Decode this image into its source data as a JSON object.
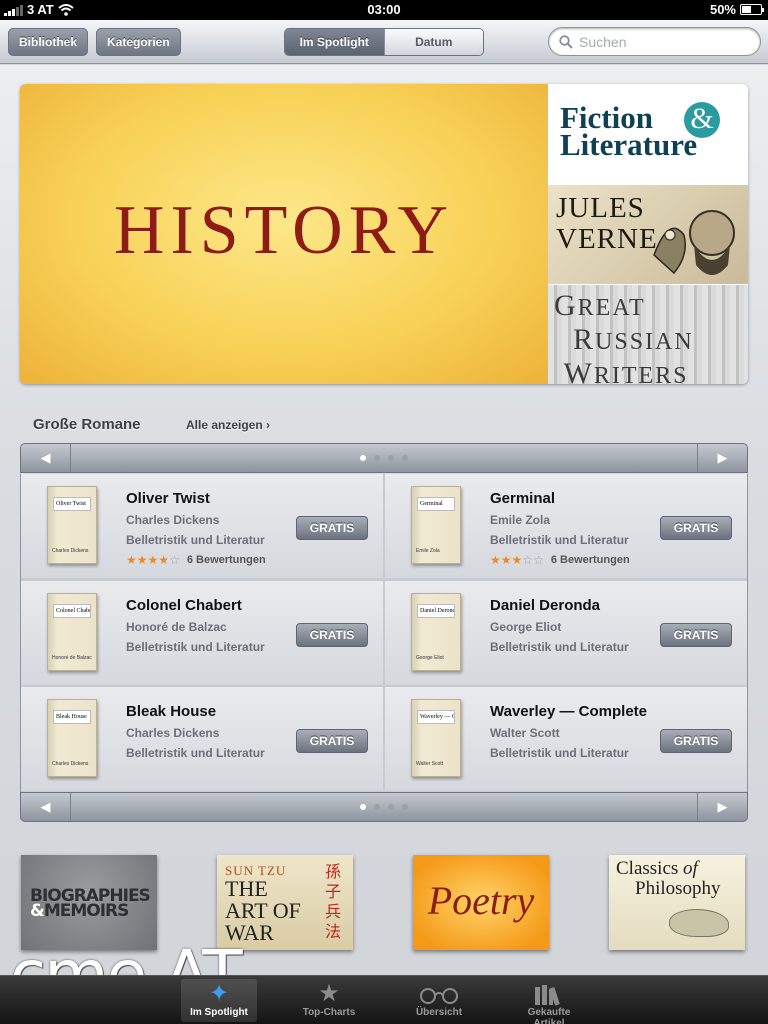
{
  "status_bar": {
    "carrier": "3 AT",
    "time": "03:00",
    "battery": "50%",
    "battery_level": 0.5
  },
  "toolbar": {
    "library_button": "Bibliothek",
    "categories_button": "Kategorien",
    "segments": [
      "Im Spotlight",
      "Datum"
    ],
    "selected_segment": "Im Spotlight",
    "search_placeholder": "Suchen"
  },
  "hero": {
    "main_banner": "HISTORY",
    "side_banners": [
      "Fiction & Literature",
      "JULES VERNE",
      "GREAT RUSSIAN WRITERS"
    ]
  },
  "section": {
    "title": "Große Romane",
    "see_all": "Alle anzeigen ›",
    "page_count": 4,
    "current_page": 1,
    "books": [
      {
        "title": "Oliver Twist",
        "author": "Charles Dickens",
        "genre": "Belletristik und Literatur",
        "price": "GRATIS",
        "stars": "★★★★☆",
        "ratings": "6 Bewertungen",
        "cover_title": "Oliver Twist",
        "cover_author": "Charles Dickens"
      },
      {
        "title": "Germinal",
        "author": "Emile Zola",
        "genre": "Belletristik und Literatur",
        "price": "GRATIS",
        "stars": "★★★☆☆",
        "ratings": "6 Bewertungen",
        "cover_title": "Germinal",
        "cover_author": "Émile Zola"
      },
      {
        "title": "Colonel Chabert",
        "author": "Honoré de Balzac",
        "genre": "Belletristik und Literatur",
        "price": "GRATIS",
        "cover_title": "Colonel Chabert",
        "cover_author": "Honoré de Balzac"
      },
      {
        "title": "Daniel Deronda",
        "author": "George Eliot",
        "genre": "Belletristik und Literatur",
        "price": "GRATIS",
        "cover_title": "Daniel Deronda",
        "cover_author": "George Eliot"
      },
      {
        "title": "Bleak House",
        "author": "Charles Dickens",
        "genre": "Belletristik und Literatur",
        "price": "GRATIS",
        "cover_title": "Bleak House",
        "cover_author": "Charles Dickens"
      },
      {
        "title": "Waverley — Complete",
        "author": "Walter Scott",
        "genre": "Belletristik und Literatur",
        "price": "GRATIS",
        "cover_title": "Waverley — Complete",
        "cover_author": "Walter Scott"
      }
    ]
  },
  "categories": {
    "biographies": "BIOGRAPHIES",
    "memoirs": "MEMOIRS",
    "sun_tzu": "SUN TZU",
    "art_of_war": "THE ART OF WAR",
    "art_of_war_chinese": "孫子兵法",
    "poetry": "Poetry",
    "philosophy": "Classics of Philosophy"
  },
  "watermark": "cmе.AT",
  "tabbar": {
    "tabs": [
      {
        "label": "Im Spotlight",
        "icon": "spotlight-icon"
      },
      {
        "label": "Top-Charts",
        "icon": "star-icon"
      },
      {
        "label": "Übersicht",
        "icon": "glasses-icon"
      },
      {
        "label": "Gekaufte Artikel",
        "icon": "books-icon"
      }
    ],
    "active": "Im Spotlight"
  },
  "colors": {
    "accent": "#3d9df0",
    "history_red": "#8e1c14",
    "star_orange": "#ee8a1f"
  }
}
